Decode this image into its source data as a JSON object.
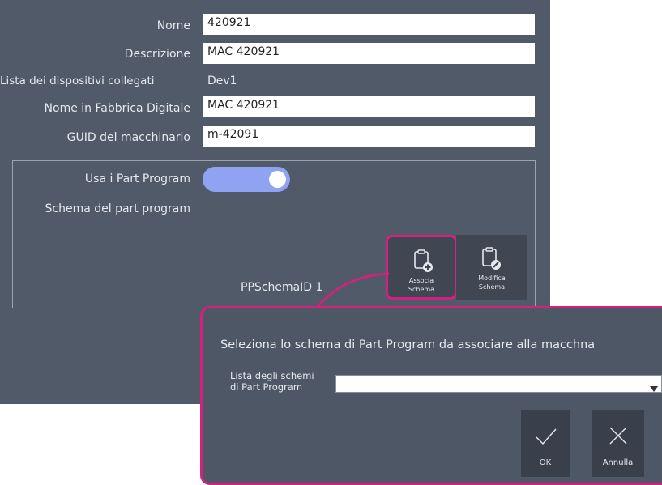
{
  "form": {
    "nome_label": "Nome",
    "nome_value": "420921",
    "descrizione_label": "Descrizione",
    "descrizione_value": "MAC 420921",
    "dispositivi_label": "Lista dei dispositivi collegati",
    "dispositivi_value": "Dev1",
    "fabbrica_label": "Nome in Fabbrica Digitale",
    "fabbrica_value": "MAC 420921",
    "guid_label": "GUID del macchinario",
    "guid_value": "m-42091"
  },
  "part_program": {
    "usa_label": "Usa i Part Program",
    "usa_enabled": true,
    "schema_label": "Schema del part program",
    "schema_id": "PPSchemaID  1",
    "associa_line1": "Associa",
    "associa_line2": "Schema",
    "modifica_line1": "Modifica",
    "modifica_line2": "Schema"
  },
  "dialog": {
    "title": "Seleziona lo schema di Part Program da associare alla macchna",
    "list_label_line1": "Lista degli schemi",
    "list_label_line2": "di Part Program",
    "selected_value": "",
    "ok_label": "OK",
    "cancel_label": "Annulla"
  },
  "colors": {
    "panel_bg": "#515a69",
    "accent": "#d4207e",
    "toggle_on": "#8fa3f2"
  }
}
